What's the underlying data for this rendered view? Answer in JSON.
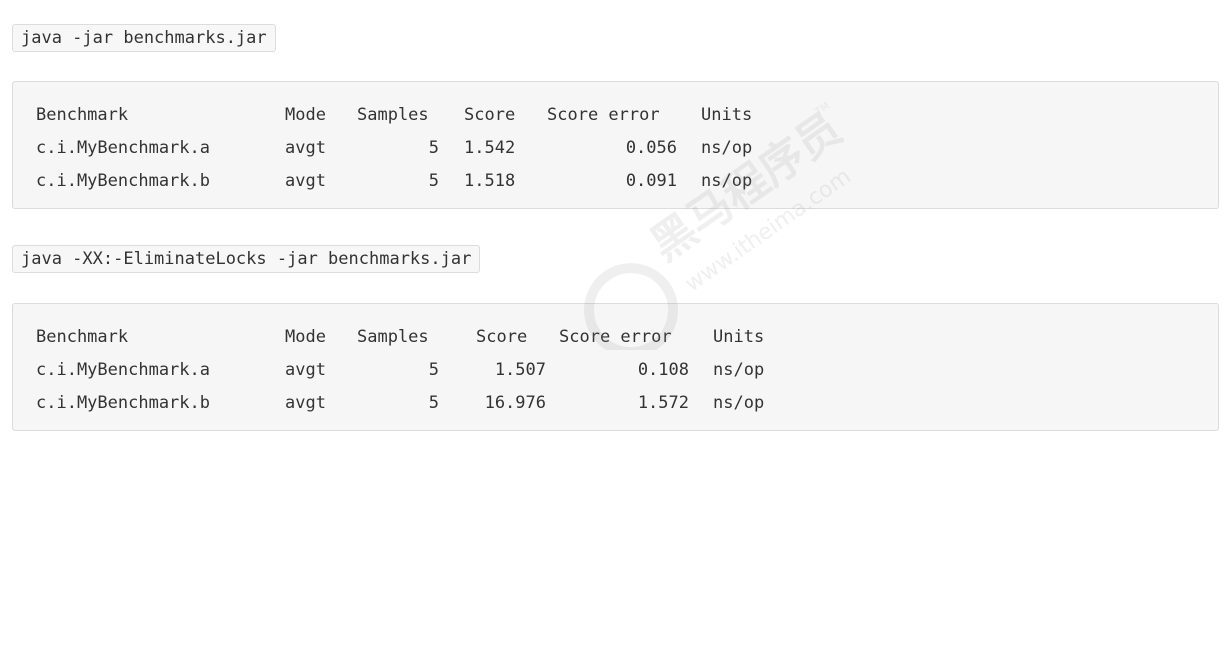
{
  "command1": "java -jar benchmarks.jar",
  "table1": {
    "headers": [
      "Benchmark",
      "Mode",
      "Samples",
      "Score",
      "Score error",
      "Units"
    ],
    "rows": [
      [
        "c.i.MyBenchmark.a",
        "avgt",
        "5",
        "1.542",
        "0.056",
        "ns/op"
      ],
      [
        "c.i.MyBenchmark.b",
        "avgt",
        "5",
        "1.518",
        "0.091",
        "ns/op"
      ]
    ]
  },
  "command2": "java -XX:-EliminateLocks -jar benchmarks.jar",
  "table2": {
    "headers": [
      "Benchmark",
      "Mode",
      "Samples",
      "Score",
      "Score error",
      "Units"
    ],
    "rows": [
      [
        "c.i.MyBenchmark.a",
        "avgt",
        "5",
        "1.507",
        "0.108",
        "ns/op"
      ],
      [
        "c.i.MyBenchmark.b",
        "avgt",
        "5",
        "16.976",
        "1.572",
        "ns/op"
      ]
    ]
  },
  "watermark": {
    "brand": "黑马程序员",
    "url": "www.itheima.com",
    "tm": "TM"
  }
}
